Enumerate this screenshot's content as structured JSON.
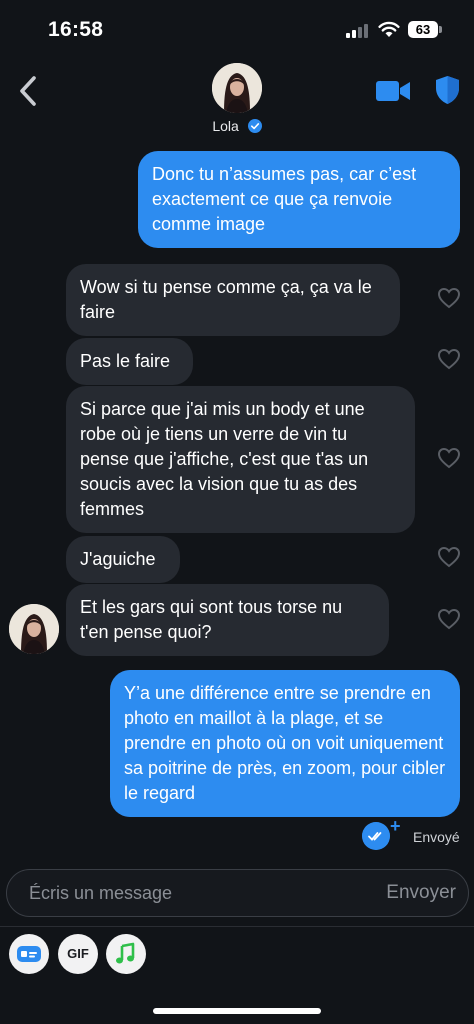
{
  "status_bar": {
    "time": "16:58",
    "battery": "63"
  },
  "header": {
    "contact_name": "Lola"
  },
  "messages": [
    {
      "direction": "out",
      "text": "Donc tu n’assumes pas, car c’est exactement ce que ça renvoie comme image"
    },
    {
      "direction": "in",
      "text": "Wow si tu pense comme ça, ça va le faire"
    },
    {
      "direction": "in",
      "text": "Pas le faire"
    },
    {
      "direction": "in",
      "text": "Si parce que j'ai mis un body et une robe où je tiens un verre de vin tu pense que j'affiche, c'est que t'as un soucis avec la vision que tu as des femmes"
    },
    {
      "direction": "in",
      "text": "J'aguiche"
    },
    {
      "direction": "in",
      "text": "Et les gars qui sont tous torse nu t'en pense quoi?"
    },
    {
      "direction": "out",
      "text": "Y’a une différence entre se prendre en photo en maillot à la plage, et se prendre en photo où on voit uniquement sa poitrine de près, en zoom, pour cibler le regard"
    }
  ],
  "delivery_status": "Envoyé",
  "composer": {
    "placeholder": "Écris un message",
    "send_label": "Envoyer"
  },
  "toolbar": {
    "gif_label": "GIF"
  },
  "colors": {
    "accent": "#2d8cf0",
    "incoming_bubble": "#262a31",
    "background": "#111418"
  },
  "icons": [
    "back-icon",
    "verified-icon",
    "video-call-icon",
    "shield-icon",
    "heart-icon",
    "sticker-icon",
    "music-icon"
  ]
}
